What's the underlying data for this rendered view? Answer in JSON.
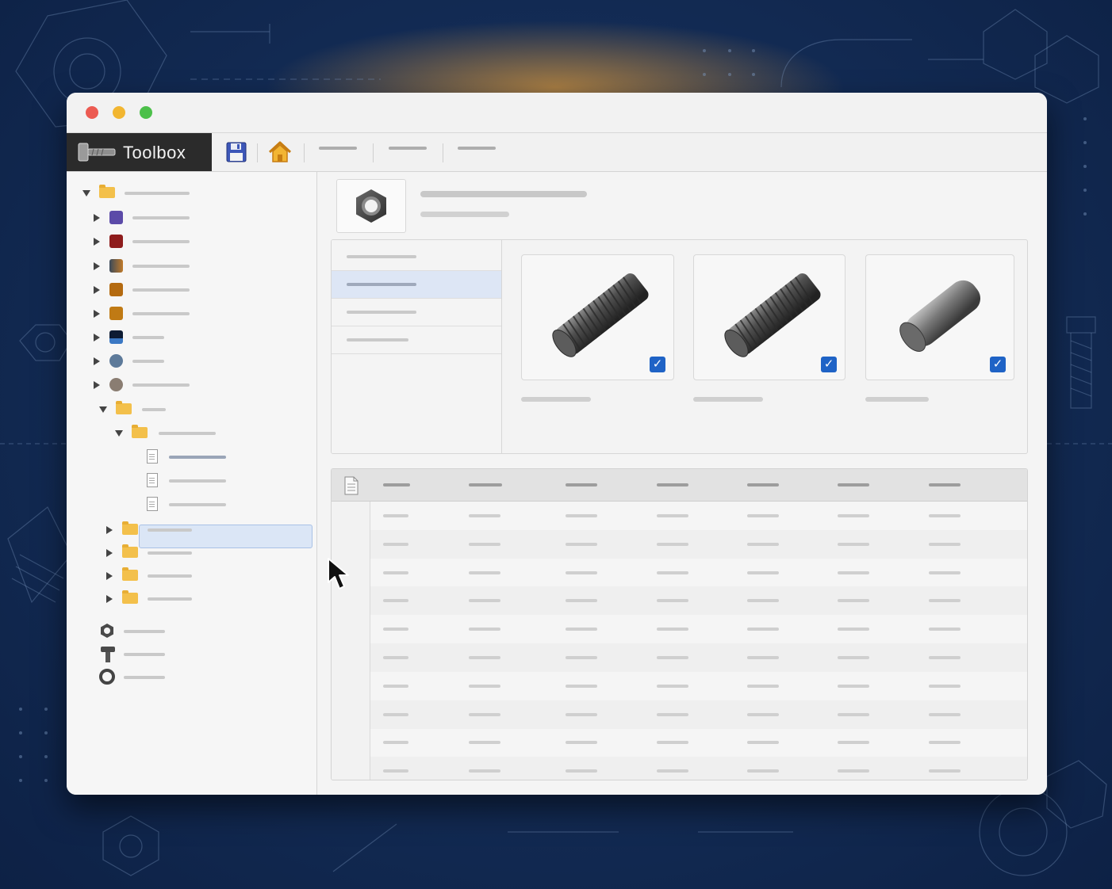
{
  "app": {
    "brand_label": "Toolbox"
  },
  "window": {
    "controls": [
      "close",
      "minimize",
      "zoom"
    ]
  },
  "toolbar": {
    "buttons": [
      {
        "icon": "save-icon"
      },
      {
        "icon": "home-icon"
      }
    ],
    "menu_items": [
      "",
      "",
      ""
    ]
  },
  "sidebar": {
    "tree": [
      {
        "kind": "folder",
        "expanded": true,
        "label": ""
      },
      {
        "kind": "material",
        "color": "#5b4aa8",
        "label": ""
      },
      {
        "kind": "material",
        "color": "#8e1c1c",
        "label": ""
      },
      {
        "kind": "material",
        "color": "#4a5560",
        "label": ""
      },
      {
        "kind": "material",
        "color": "#b46a10",
        "label": ""
      },
      {
        "kind": "material",
        "color": "#c07a14",
        "label": ""
      },
      {
        "kind": "material",
        "color": "#152a4a",
        "label": ""
      },
      {
        "kind": "material",
        "color": "#5d7a9a",
        "label": ""
      },
      {
        "kind": "material",
        "color": "#8a7d72",
        "label": ""
      },
      {
        "kind": "folder",
        "expanded": true,
        "label": ""
      },
      {
        "kind": "folder",
        "expanded": true,
        "label": ""
      },
      {
        "kind": "document",
        "selected": true,
        "label": ""
      },
      {
        "kind": "document",
        "label": ""
      },
      {
        "kind": "document",
        "label": ""
      },
      {
        "kind": "folder",
        "expanded": false,
        "label": ""
      },
      {
        "kind": "folder",
        "expanded": false,
        "label": ""
      },
      {
        "kind": "folder",
        "expanded": false,
        "label": ""
      },
      {
        "kind": "folder",
        "expanded": false,
        "label": ""
      },
      {
        "kind": "part",
        "icon": "hex-nut-icon",
        "label": ""
      },
      {
        "kind": "part",
        "icon": "bolt-icon",
        "label": ""
      },
      {
        "kind": "part",
        "icon": "washer-icon",
        "label": ""
      }
    ]
  },
  "detail": {
    "header": {
      "icon": "hex-nut-icon",
      "title": "",
      "subtitle": ""
    },
    "list_items": [
      {
        "label": "",
        "active": false
      },
      {
        "label": "",
        "active": true
      },
      {
        "label": "",
        "active": false
      },
      {
        "label": "",
        "active": false
      }
    ],
    "cards": [
      {
        "icon": "threaded-rod-icon",
        "checked": true,
        "caption": ""
      },
      {
        "icon": "threaded-rod-icon",
        "checked": true,
        "caption": ""
      },
      {
        "icon": "dowel-pin-icon",
        "checked": true,
        "caption": ""
      }
    ]
  },
  "table": {
    "header_icon": "document-icon",
    "columns": [
      "",
      "",
      "",
      "",
      "",
      "",
      ""
    ],
    "rows": [
      [
        "",
        "",
        "",
        "",
        "",
        "",
        ""
      ],
      [
        "",
        "",
        "",
        "",
        "",
        "",
        ""
      ],
      [
        "",
        "",
        "",
        "",
        "",
        "",
        ""
      ],
      [
        "",
        "",
        "",
        "",
        "",
        "",
        ""
      ],
      [
        "",
        "",
        "",
        "",
        "",
        "",
        ""
      ],
      [
        "",
        "",
        "",
        "",
        "",
        "",
        ""
      ],
      [
        "",
        "",
        "",
        "",
        "",
        "",
        ""
      ],
      [
        "",
        "",
        "",
        "",
        "",
        "",
        ""
      ],
      [
        "",
        "",
        "",
        "",
        "",
        "",
        ""
      ],
      [
        "",
        "",
        "",
        "",
        "",
        "",
        ""
      ]
    ]
  },
  "colors": {
    "accent": "#1f63c6",
    "selection": "#dbe6f6",
    "brand_bar": "#2b2b2b",
    "folder": "#f3c04b",
    "background": "#142d57"
  }
}
